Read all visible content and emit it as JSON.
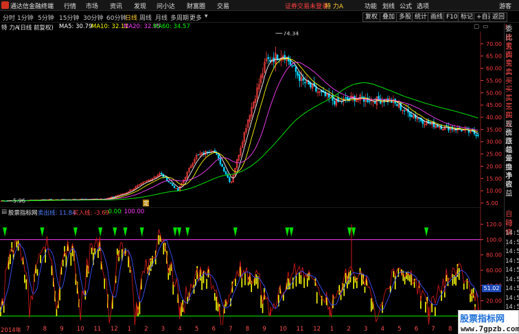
{
  "menubar": {
    "app_title": "通达信金融终端",
    "items": [
      "行情",
      "市场",
      "资讯",
      "发现",
      "问小达",
      "财富圈",
      "交易"
    ],
    "notice": "证券交易未登录",
    "stock": "特 力A",
    "right_items": [
      "功能",
      "划线",
      "公式",
      "选项"
    ],
    "guest": "游客"
  },
  "periodbar": {
    "periods": [
      "分时",
      "1分钟",
      "5分钟",
      "15分钟",
      "30分钟",
      "60分钟",
      "日线",
      "周线",
      "月线",
      "多周期",
      "更多"
    ],
    "active_index": 6,
    "tools": [
      "复权",
      "叠加",
      "多股",
      "统计",
      "画线",
      "F10",
      "标记",
      "+自选",
      "返回"
    ]
  },
  "chart_header": {
    "stock_name": "特 力A",
    "mode": "(日线 前复权)",
    "ma5": "MA5: 30.79",
    "ma10": "MA10: 32.11",
    "ma20": "MA20: 32.95",
    "ma60": "MA60: 34.57"
  },
  "sub_header": {
    "indicator_name": "股票指标网",
    "sell_line": "卖出线: 11.84",
    "buy_line": "买入线: -3.69",
    "v1": ": 0.00",
    "v2": ": 100.00"
  },
  "right_panel": {
    "corner": "L",
    "labels": [
      "委比",
      "卖五",
      "卖四",
      "卖三",
      "卖二",
      "卖一",
      "买一",
      "买二",
      "买三",
      "买四",
      "买五",
      "现价",
      "涨跌",
      "涨幅",
      "总量",
      "外盘",
      "换手",
      "净资",
      "收益"
    ],
    "labels2": [
      "自动",
      "行情"
    ],
    "times": [
      "14:5",
      "14:5",
      "14:5",
      "14:5",
      "14:5",
      "14:5",
      "14:5",
      "14:5",
      "14:5",
      "14:5"
    ]
  },
  "date_axis": [
    "2014年",
    "7",
    "8",
    "9",
    "10",
    "11",
    "12",
    "1",
    "2",
    "3",
    "4",
    "5",
    "6",
    "7",
    "8",
    "9",
    "10",
    "11",
    "12",
    "1",
    "2",
    "3",
    "4",
    "5",
    "6",
    "7",
    "8",
    "9"
  ],
  "watermark": {
    "title": "股票指标网",
    "url": "www.7gpzb.com"
  },
  "colors": {
    "up": "#ff4040",
    "down": "#00d8ff",
    "ma5": "#ffffff",
    "ma10": "#ffff00",
    "ma20": "#ff40ff",
    "ma60": "#00ff00",
    "axis": "#ff4040",
    "accent_yellow": "#ffcc33"
  },
  "chart_data": [
    {
      "type": "candlestick",
      "title": "",
      "x": [
        "2014年",
        "7",
        "8",
        "9",
        "10",
        "11",
        "12",
        "1",
        "2",
        "3",
        "4",
        "5",
        "6",
        "7",
        "8",
        "9",
        "10",
        "11",
        "12",
        "1",
        "2",
        "3",
        "4",
        "5",
        "6",
        "7",
        "8",
        "9"
      ],
      "close_approx": [
        5.9,
        6.0,
        6.2,
        6.3,
        6.4,
        6.5,
        6.8,
        9.0,
        13.0,
        17.0,
        10.0,
        24.0,
        27.0,
        13.0,
        40.0,
        63.0,
        66.0,
        55.0,
        50.0,
        46.0,
        48.0,
        47.0,
        47.0,
        42.0,
        38.0,
        36.0,
        35.0,
        33.0
      ],
      "series": [
        {
          "name": "MA5",
          "value": 30.79
        },
        {
          "name": "MA10",
          "value": 32.11
        },
        {
          "name": "MA20",
          "value": 32.95
        },
        {
          "name": "MA60",
          "value": 34.57
        }
      ],
      "annotations": [
        {
          "text": "74.34"
        },
        {
          "text": "5.96"
        },
        {
          "text": "定"
        }
      ],
      "y_ticks": [
        "70.00",
        "65.00",
        "60.00",
        "55.00",
        "50.00",
        "45.00",
        "40.00",
        "35.00",
        "30.00",
        "25.00",
        "20.00",
        "15.00",
        "10.00",
        "5.00"
      ],
      "ylim": [
        5,
        75
      ]
    },
    {
      "type": "line",
      "title": "",
      "series": [
        {
          "name": "卖出线",
          "value": 11.84
        },
        {
          "name": "买入线",
          "value": -3.69
        }
      ],
      "reference_lines": [
        0.0,
        100.0
      ],
      "y_ticks": [
        "120.0",
        "100.0",
        "80.00",
        "60.00",
        "40.00",
        "20.00"
      ],
      "ylim": [
        -10,
        130
      ],
      "last_value_label": "51.02"
    }
  ]
}
